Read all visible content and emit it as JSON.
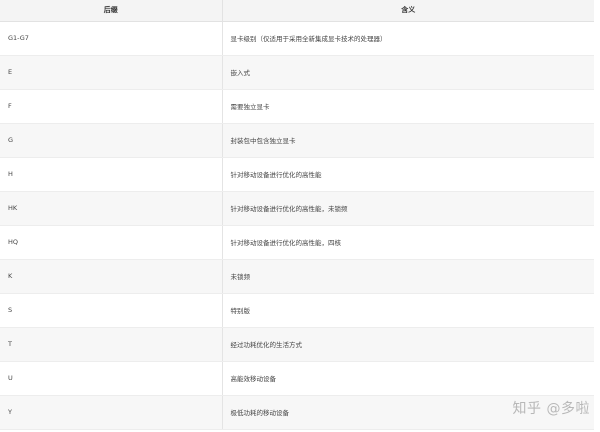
{
  "table": {
    "headers": [
      "后缀",
      "含义"
    ],
    "rows": [
      {
        "suffix": "G1-G7",
        "meaning": "显卡级别（仅适用于采用全新集成显卡技术的处理器）"
      },
      {
        "suffix": "E",
        "meaning": "嵌入式"
      },
      {
        "suffix": "F",
        "meaning": "需要独立显卡"
      },
      {
        "suffix": "G",
        "meaning": "封装包中包含独立显卡"
      },
      {
        "suffix": "H",
        "meaning": "针对移动设备进行优化的高性能"
      },
      {
        "suffix": "HK",
        "meaning": "针对移动设备进行优化的高性能，未锁频"
      },
      {
        "suffix": "HQ",
        "meaning": "针对移动设备进行优化的高性能，四核"
      },
      {
        "suffix": "K",
        "meaning": "未锁频"
      },
      {
        "suffix": "S",
        "meaning": "特别版"
      },
      {
        "suffix": "T",
        "meaning": "经过功耗优化的生活方式"
      },
      {
        "suffix": "U",
        "meaning": "高能效移动设备"
      },
      {
        "suffix": "Y",
        "meaning": "极低功耗的移动设备"
      }
    ]
  },
  "watermark": "知乎 @多啦"
}
